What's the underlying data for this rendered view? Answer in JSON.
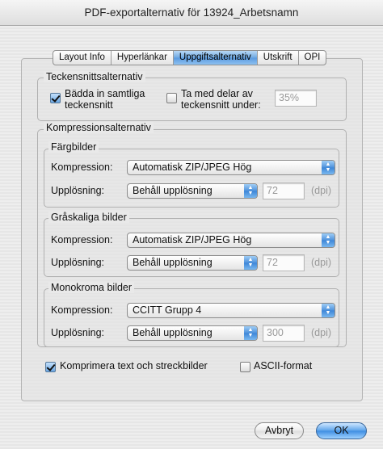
{
  "window": {
    "title": "PDF-exportalternativ för 13924_Arbetsnamn"
  },
  "tabs": [
    "Layout Info",
    "Hyperlänkar",
    "Uppgiftsalternativ",
    "Utskrift",
    "OPI"
  ],
  "selected_tab": "Uppgiftsalternativ",
  "font_options": {
    "title": "Teckensnittsalternativ",
    "embed_all_line1": "Bädda in samtliga",
    "embed_all_line2": "teckensnitt",
    "embed_all_checked": true,
    "subset_line1": "Ta med delar av",
    "subset_line2": "teckensnitt under:",
    "subset_checked": false,
    "subset_value": "35%"
  },
  "compression": {
    "title": "Kompressionsalternativ",
    "compression_label": "Kompression:",
    "resolution_label": "Upplösning:",
    "dpi_unit": "(dpi)",
    "color": {
      "title": "Färgbilder",
      "compression": "Automatisk ZIP/JPEG Hög",
      "resolution": "Behåll upplösning",
      "dpi": "72"
    },
    "gray": {
      "title": "Gråskaliga bilder",
      "compression": "Automatisk ZIP/JPEG Hög",
      "resolution": "Behåll upplösning",
      "dpi": "72"
    },
    "mono": {
      "title": "Monokroma bilder",
      "compression": "CCITT Grupp 4",
      "resolution": "Behåll upplösning",
      "dpi": "300"
    }
  },
  "compress_text": {
    "label": "Komprimera text och streckbilder",
    "checked": true
  },
  "ascii": {
    "label": "ASCII-format",
    "checked": false
  },
  "buttons": {
    "cancel": "Avbryt",
    "ok": "OK"
  }
}
